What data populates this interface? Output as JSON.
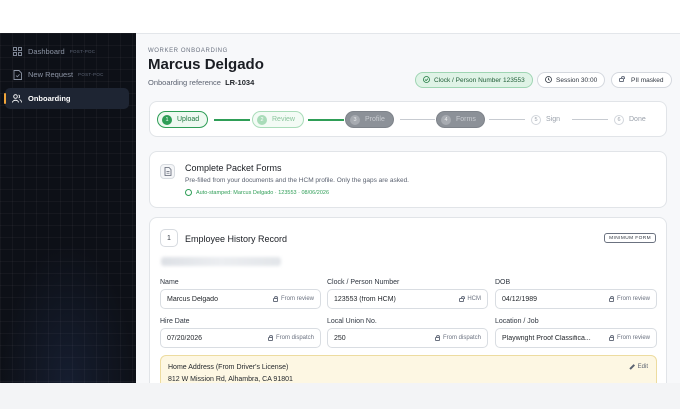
{
  "sidebar": {
    "items": [
      {
        "label": "Dashboard",
        "tag": "POST-POC",
        "icon": "grid-icon"
      },
      {
        "label": "New Request",
        "tag": "POST-POC",
        "icon": "document-icon"
      },
      {
        "label": "Onboarding",
        "tag": "",
        "icon": "users-icon",
        "active": true
      }
    ]
  },
  "header": {
    "eyebrow": "WORKER ONBOARDING",
    "title": "Marcus Delgado",
    "reference_label": "Onboarding reference",
    "reference_value": "LR-1034",
    "clock_pill": "Clock / Person Number  123553",
    "session_pill": "Session  30:00",
    "pii_pill": "PII masked"
  },
  "stepper": {
    "steps": [
      {
        "num": "1",
        "label": "Upload",
        "state": "done"
      },
      {
        "num": "2",
        "label": "Review",
        "state": "review"
      },
      {
        "num": "3",
        "label": "Profile",
        "state": "dark"
      },
      {
        "num": "4",
        "label": "Forms",
        "state": "dark"
      },
      {
        "num": "5",
        "label": "Sign",
        "state": "plain"
      },
      {
        "num": "6",
        "label": "Done",
        "state": "plain"
      }
    ]
  },
  "packet_card": {
    "title": "Complete Packet Forms",
    "description": "Pre-filled from your documents and the HCM profile. Only the gaps are asked.",
    "stamp": "Auto-stamped: Marcus Delgado · 123553 · 08/06/2026"
  },
  "history_card": {
    "number": "1",
    "title": "Employee History Record",
    "badge": "MINIMUM FORM",
    "fields": [
      {
        "label": "Name",
        "value": "Marcus Delgado",
        "hint": "From review"
      },
      {
        "label": "Clock / Person Number",
        "value": "123553 (from HCM)",
        "hint": "HCM"
      },
      {
        "label": "DOB",
        "value": "04/12/1989",
        "hint": "From review"
      },
      {
        "label": "Hire Date",
        "value": "07/20/2026",
        "hint": "From dispatch"
      },
      {
        "label": "Local Union No.",
        "value": "250",
        "hint": "From dispatch"
      },
      {
        "label": "Location / Job",
        "value": "Playwright Proof Classifica...",
        "hint": "From review"
      }
    ],
    "address": {
      "label": "Home Address (From Driver's License)",
      "value": "812 W Mission Rd, Alhambra, CA 91801",
      "edit_label": "Edit"
    }
  },
  "colors": {
    "sidebar_bg": "#0d1017",
    "accent_orange": "#f0a53a",
    "success_green": "#2f9e57",
    "address_bg": "#fdf7e3"
  }
}
